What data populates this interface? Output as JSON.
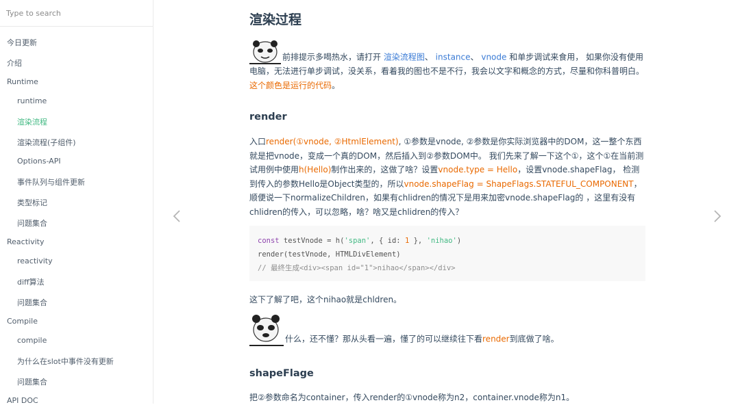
{
  "sidebar": {
    "search_placeholder": "Type to search",
    "items": [
      {
        "label": "今日更新",
        "level": 0,
        "active": false
      },
      {
        "label": "介绍",
        "level": 0,
        "active": false
      },
      {
        "label": "Runtime",
        "level": 0,
        "active": false
      },
      {
        "label": "runtime",
        "level": 1,
        "active": false
      },
      {
        "label": "渲染流程",
        "level": 1,
        "active": true
      },
      {
        "label": "渲染流程(子组件)",
        "level": 1,
        "active": false
      },
      {
        "label": "Options-API",
        "level": 1,
        "active": false
      },
      {
        "label": "事件队列与组件更新",
        "level": 1,
        "active": false
      },
      {
        "label": "类型标记",
        "level": 1,
        "active": false
      },
      {
        "label": "问题集合",
        "level": 1,
        "active": false
      },
      {
        "label": "Reactivity",
        "level": 0,
        "active": false
      },
      {
        "label": "reactivity",
        "level": 1,
        "active": false
      },
      {
        "label": "diff算法",
        "level": 1,
        "active": false
      },
      {
        "label": "问题集合",
        "level": 1,
        "active": false
      },
      {
        "label": "Compile",
        "level": 0,
        "active": false
      },
      {
        "label": "compile",
        "level": 1,
        "active": false
      },
      {
        "label": "为什么在slot中事件没有更新",
        "level": 1,
        "active": false
      },
      {
        "label": "问题集合",
        "level": 1,
        "active": false
      },
      {
        "label": "API DOC",
        "level": 0,
        "active": false
      }
    ]
  },
  "content": {
    "title": "渲染过程",
    "intro": {
      "t1": "前排提示多喝热水，请打开 ",
      "link1": "渲染流程图",
      "sep1": "、 ",
      "link2": "instance",
      "sep2": "、 ",
      "link3": "vnode",
      "t2": " 和单步调试来食用， 如果你没有使用电脑，无法进行单步调试，没关系，看着我的图也不是不行，我会以文字和概念的方式，尽量和你科普明白。",
      "hl": "这个颜色是运行的代码",
      "end": "。"
    },
    "h_render": "render",
    "render_para": {
      "a": "入口",
      "b": "render(①vnode, ②HtmlElement)",
      "c": ", ①参数是vnode, ②参数是你实际浏览器中的DOM，这一整个东西就是把vnode，变成一个真的DOM，然后插入到②参数DOM中。 我们先来了解一下这个①，这个①在当前测试用例中使用",
      "d": "h(Hello)",
      "e": "制作出来的，这做了啥？设置",
      "f": "vnode.type = Hello",
      "g": "，设置vnode.shapeFlag， 检测到传入的参数Hello是Object类型的，所以",
      "h": "vnode.shapeFlag = ShapeFlags.STATEFUL_COMPONENT",
      "i": "，顺便说一下normalizeChildren，如果有chlidren的情况下是用来加密vnode.shapeFlag的 ，这里有没有chlidren的传入，可以忽略，啥？啥又是chlidren的传入？"
    },
    "code": {
      "l1_kw": "const",
      "l1_a": " testVnode = h(",
      "l1_s1": "'span'",
      "l1_b": ", { id: ",
      "l1_n": "1",
      "l1_c": " }, ",
      "l1_s2": "'nihao'",
      "l1_d": ")",
      "l2": "render(testVnode, HTMLDivElement)",
      "l3": "// 最终生成<div><span id=\"1\">nihao</span></div>"
    },
    "after_code": "这下了解了吧，这个nihao就是chldren。",
    "meme2": {
      "a": "什么，还不懂？那从头看一遍，懂了的可以继续往下看",
      "hl": "render",
      "b": "到底做了啥。"
    },
    "h_shape": "shapeFlage",
    "shape_para": "把②参数命名为container，传入render的①vnode称为n2，container.vnode称为n1。"
  },
  "nav": {
    "prev_icon": "chevron-left-icon",
    "next_icon": "chevron-right-icon"
  },
  "colors": {
    "accent": "#42b983",
    "highlight": "#e96900",
    "link": "#3a7bd5",
    "text": "#34495e",
    "code_bg": "#f8f8f8"
  }
}
